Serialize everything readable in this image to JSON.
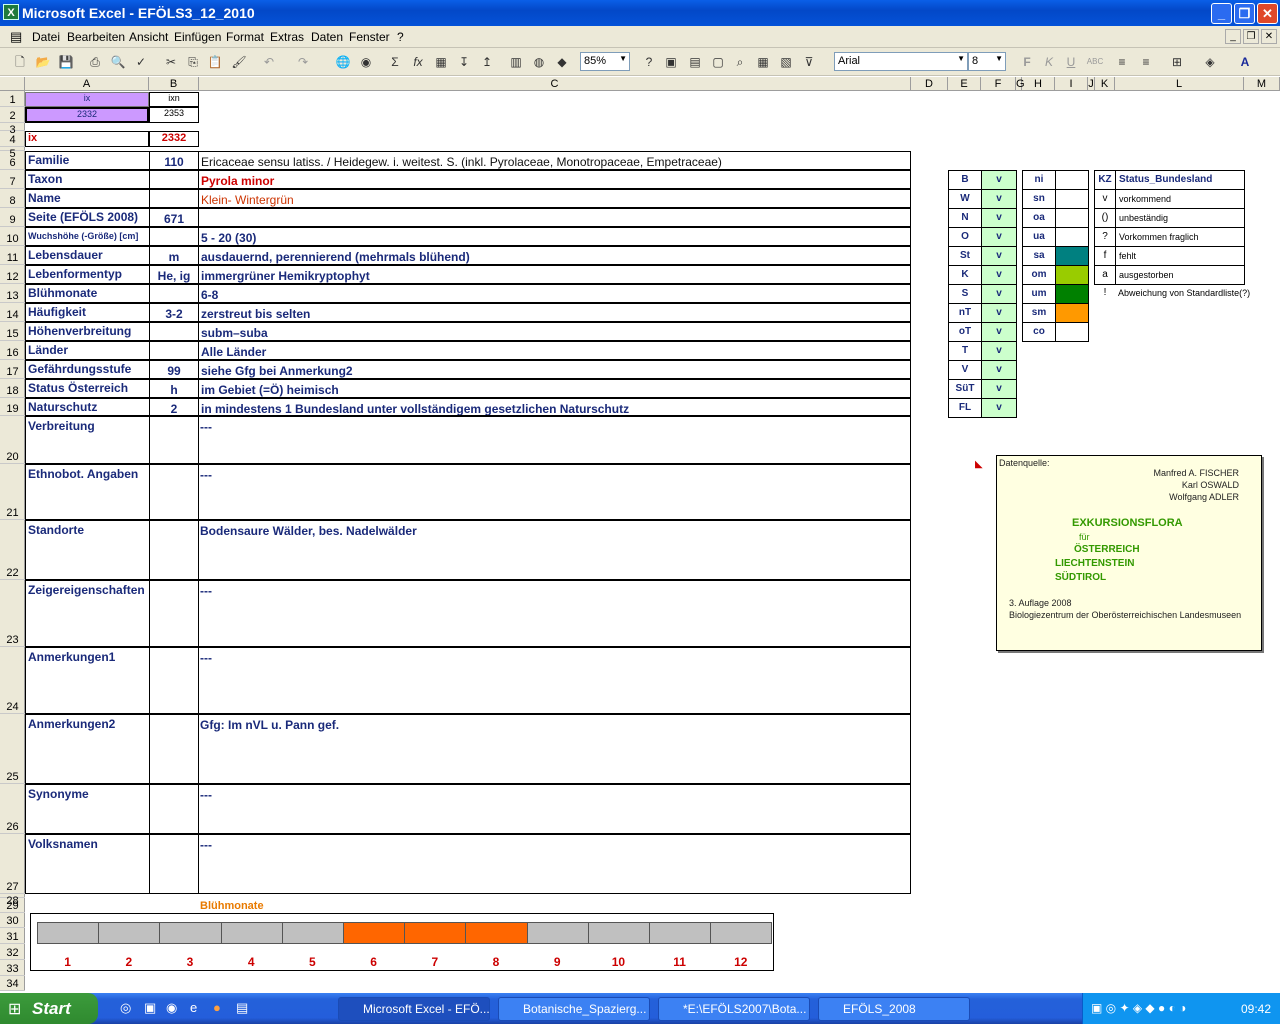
{
  "window": {
    "title": "Microsoft Excel - EFÖLS3_12_2010",
    "min": "_",
    "max": "❐",
    "close": "✕"
  },
  "menu": [
    "Datei",
    "Bearbeiten",
    "Ansicht",
    "Einfügen",
    "Format",
    "Extras",
    "Daten",
    "Fenster",
    "?"
  ],
  "toolbar": {
    "zoom": "85%",
    "font": "Arial",
    "size": "8"
  },
  "columns": [
    "A",
    "B",
    "C",
    "D",
    "E",
    "F",
    "G",
    "H",
    "I",
    "J",
    "K",
    "L",
    "M"
  ],
  "rows": [
    "1",
    "2",
    "3",
    "4",
    "5",
    "6",
    "7",
    "8",
    "9",
    "10",
    "11",
    "12",
    "13",
    "14",
    "15",
    "16",
    "17",
    "18",
    "19",
    "20",
    "21",
    "22",
    "23",
    "24",
    "25",
    "26",
    "27",
    "28",
    "29",
    "30",
    "31",
    "32",
    "33",
    "34"
  ],
  "top": {
    "a1": "ix",
    "b1": "ixn",
    "a2": "2332",
    "b2": "2353",
    "a4": "ix",
    "b4": "2332"
  },
  "fields": [
    {
      "label": "Familie",
      "code": "110",
      "text": "Ericaceae sensu latiss.  /  Heidegew. i. weitest. S. (inkl. Pyrolaceae, Monotropaceae, Empetraceae)"
    },
    {
      "label": "Taxon",
      "code": "",
      "text": "Pyrola minor"
    },
    {
      "label": "Name",
      "code": "",
      "text": "Klein- Wintergrün"
    },
    {
      "label": "Seite (EFÖLS 2008)",
      "code": "671",
      "text": ""
    },
    {
      "label": "Wuchshöhe (-Größe) [cm]",
      "code": "",
      "text": " 5 - 20 (30)"
    },
    {
      "label": "Lebensdauer",
      "code": "m",
      "text": "ausdauernd, perennierend (mehrmals blühend)"
    },
    {
      "label": "Lebenformentyp",
      "code": "He, ig",
      "text": "immergrüner Hemikryptophyt"
    },
    {
      "label": "Blühmonate",
      "code": "",
      "text": " 6-8"
    },
    {
      "label": "Häufigkeit",
      "code": "3-2",
      "text": "zerstreut bis selten"
    },
    {
      "label": "Höhenverbreitung",
      "code": "",
      "text": "subm–suba"
    },
    {
      "label": "Länder",
      "code": "",
      "text": "Alle Länder"
    },
    {
      "label": "Gefährdungsstufe",
      "code": "99",
      "text": "siehe Gfg bei Anmerkung2"
    },
    {
      "label": "Status Österreich",
      "code": "h",
      "text": "im Gebiet (=Ö) heimisch"
    },
    {
      "label": "Naturschutz",
      "code": "2",
      "text": "in mindestens 1 Bundesland unter vollständigem gesetzlichen Naturschutz"
    }
  ],
  "bigfields": [
    {
      "label": "Verbreitung",
      "text": " ---"
    },
    {
      "label": "Ethnobot. Angaben",
      "text": "---"
    },
    {
      "label": "Standorte",
      "text": "Bodensaure Wälder, bes. Nadelwälder"
    },
    {
      "label": "Zeigereigenschaften",
      "text": "---"
    },
    {
      "label": "Anmerkungen1",
      "text": "---"
    },
    {
      "label": "Anmerkungen2",
      "text": "Gfg:  Im nVL u. Pann gef."
    },
    {
      "label": "Synonyme",
      "text": "---"
    },
    {
      "label": "Volksnamen",
      "text": "---"
    }
  ],
  "states": [
    {
      "k": "B",
      "v": "v"
    },
    {
      "k": "W",
      "v": "v"
    },
    {
      "k": "N",
      "v": "v"
    },
    {
      "k": "O",
      "v": "v"
    },
    {
      "k": "St",
      "v": "v"
    },
    {
      "k": "K",
      "v": "v"
    },
    {
      "k": "S",
      "v": "v"
    },
    {
      "k": "nT",
      "v": "v"
    },
    {
      "k": "oT",
      "v": "v"
    },
    {
      "k": "T",
      "v": "v"
    },
    {
      "k": "V",
      "v": "v"
    },
    {
      "k": "SüT",
      "v": "v"
    },
    {
      "k": "FL",
      "v": "v"
    }
  ],
  "zones": [
    {
      "k": "ni",
      "color": ""
    },
    {
      "k": "sn",
      "color": ""
    },
    {
      "k": "oa",
      "color": ""
    },
    {
      "k": "ua",
      "color": ""
    },
    {
      "k": "sa",
      "color": "#008080"
    },
    {
      "k": "om",
      "color": "#99cc00"
    },
    {
      "k": "um",
      "color": "#008000"
    },
    {
      "k": "sm",
      "color": "#ff9900"
    },
    {
      "k": "co",
      "color": ""
    }
  ],
  "legend": {
    "head_kz": "KZ",
    "head": "Status_Bundesland",
    "items": [
      {
        "k": "v",
        "t": "vorkommend"
      },
      {
        "k": "()",
        "t": "unbeständig"
      },
      {
        "k": "?",
        "t": "Vorkommen fraglich"
      },
      {
        "k": "f",
        "t": "fehlt"
      },
      {
        "k": "a",
        "t": "ausgestorben"
      },
      {
        "k": "!",
        "t": "Abweichung von Standardliste(?)"
      }
    ]
  },
  "note": {
    "source": "Datenquelle:",
    "a1": "Manfred A. FISCHER",
    "a2": "Karl OSWALD",
    "a3": "Wolfgang ADLER",
    "t1": "EXKURSIONSFLORA",
    "t2": "für",
    "t3": "ÖSTERREICH",
    "t4": "LIECHTENSTEIN",
    "t5": "SÜDTIROL",
    "ed": "3. Auflage 2008",
    "pub": "Biologiezentrum der Oberösterreichischen Landesmuseen"
  },
  "bloom": {
    "title": "Blühmonate",
    "months": [
      "1",
      "2",
      "3",
      "4",
      "5",
      "6",
      "7",
      "8",
      "9",
      "10",
      "11",
      "12"
    ],
    "active": [
      6,
      7,
      8
    ]
  },
  "taskbar": {
    "start": "Start",
    "tasks": [
      "Microsoft Excel - EFÖ...",
      "Botanische_Spazierg...",
      "*E:\\EFÖLS2007\\Bota...",
      "EFÖLS_2008"
    ],
    "clock": "09:42"
  },
  "colors": {
    "accent": "#1a2a7a",
    "taxon_red": "#cc0000",
    "bloom_active": "#ff6600",
    "selection": "#cc99ff"
  }
}
